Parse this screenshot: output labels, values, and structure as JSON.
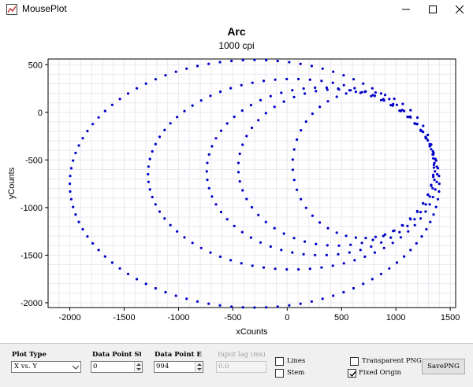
{
  "window": {
    "title": "MousePlot",
    "icon": "chart-app-icon",
    "buttons": [
      "minimize-icon",
      "maximize-icon",
      "close-icon"
    ]
  },
  "controls": {
    "plot_type_label": "Plot Type",
    "plot_type_value": "X vs. Y",
    "data_point_start_label": "Data Point Start",
    "data_point_start_value": "0",
    "data_point_end_label": "Data Point End",
    "data_point_end_value": "994",
    "input_lag_label": "Input lag (ms)",
    "input_lag_value": "0.0",
    "lines_label": "Lines",
    "lines_checked": false,
    "stem_label": "Stem",
    "stem_checked": false,
    "transparent_label": "Transparent PNG",
    "transparent_checked": false,
    "fixed_label": "Fixed Origin",
    "fixed_checked": true,
    "save_label": "SavePNG"
  },
  "colors": {
    "series": "#0000c8",
    "grid": "#e8e8f0",
    "axis": "#000000"
  },
  "chart_data": {
    "type": "scatter",
    "title": "Arc",
    "subtitle": "1000 cpi",
    "xlabel": "xCounts",
    "ylabel": "yCounts",
    "xlim": [
      -2200,
      1550
    ],
    "ylim": [
      -2050,
      560
    ],
    "xticks": [
      -2000,
      -1500,
      -1000,
      -500,
      0,
      500,
      1000,
      1500
    ],
    "yticks": [
      500,
      0,
      -500,
      -1000,
      -1500,
      -2000
    ],
    "grid": true,
    "series": [
      {
        "color": "#0000c8",
        "loops": [
          {
            "cx": -300,
            "cy": -750,
            "rx": 1700,
            "ry": 1300
          },
          {
            "cx": 50,
            "cy": -650,
            "rx": 1330,
            "ry": 1000
          },
          {
            "cx": 310,
            "cy": -620,
            "rx": 1050,
            "ry": 880
          },
          {
            "cx": 450,
            "cy": -580,
            "rx": 900,
            "ry": 820
          },
          {
            "cx": 700,
            "cy": -550,
            "rx": 650,
            "ry": 770
          }
        ]
      }
    ]
  }
}
